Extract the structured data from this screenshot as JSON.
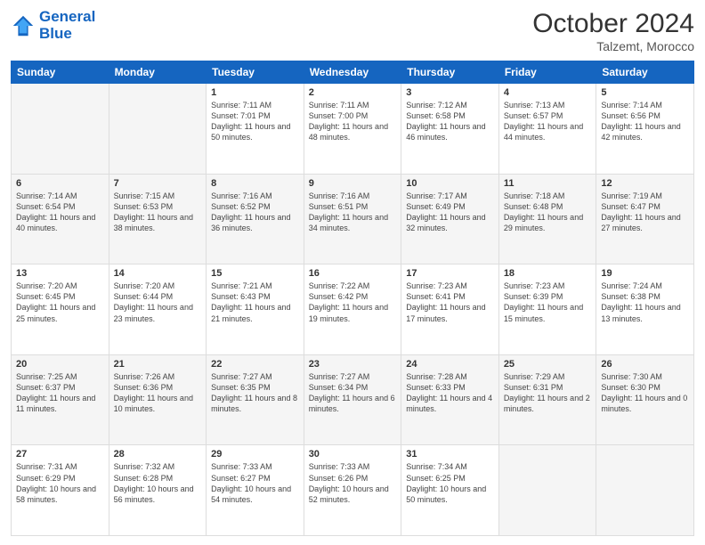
{
  "header": {
    "logo_line1": "General",
    "logo_line2": "Blue",
    "month_year": "October 2024",
    "location": "Talzemt, Morocco"
  },
  "days_of_week": [
    "Sunday",
    "Monday",
    "Tuesday",
    "Wednesday",
    "Thursday",
    "Friday",
    "Saturday"
  ],
  "weeks": [
    [
      {
        "day": "",
        "info": ""
      },
      {
        "day": "",
        "info": ""
      },
      {
        "day": "1",
        "info": "Sunrise: 7:11 AM\nSunset: 7:01 PM\nDaylight: 11 hours and 50 minutes."
      },
      {
        "day": "2",
        "info": "Sunrise: 7:11 AM\nSunset: 7:00 PM\nDaylight: 11 hours and 48 minutes."
      },
      {
        "day": "3",
        "info": "Sunrise: 7:12 AM\nSunset: 6:58 PM\nDaylight: 11 hours and 46 minutes."
      },
      {
        "day": "4",
        "info": "Sunrise: 7:13 AM\nSunset: 6:57 PM\nDaylight: 11 hours and 44 minutes."
      },
      {
        "day": "5",
        "info": "Sunrise: 7:14 AM\nSunset: 6:56 PM\nDaylight: 11 hours and 42 minutes."
      }
    ],
    [
      {
        "day": "6",
        "info": "Sunrise: 7:14 AM\nSunset: 6:54 PM\nDaylight: 11 hours and 40 minutes."
      },
      {
        "day": "7",
        "info": "Sunrise: 7:15 AM\nSunset: 6:53 PM\nDaylight: 11 hours and 38 minutes."
      },
      {
        "day": "8",
        "info": "Sunrise: 7:16 AM\nSunset: 6:52 PM\nDaylight: 11 hours and 36 minutes."
      },
      {
        "day": "9",
        "info": "Sunrise: 7:16 AM\nSunset: 6:51 PM\nDaylight: 11 hours and 34 minutes."
      },
      {
        "day": "10",
        "info": "Sunrise: 7:17 AM\nSunset: 6:49 PM\nDaylight: 11 hours and 32 minutes."
      },
      {
        "day": "11",
        "info": "Sunrise: 7:18 AM\nSunset: 6:48 PM\nDaylight: 11 hours and 29 minutes."
      },
      {
        "day": "12",
        "info": "Sunrise: 7:19 AM\nSunset: 6:47 PM\nDaylight: 11 hours and 27 minutes."
      }
    ],
    [
      {
        "day": "13",
        "info": "Sunrise: 7:20 AM\nSunset: 6:45 PM\nDaylight: 11 hours and 25 minutes."
      },
      {
        "day": "14",
        "info": "Sunrise: 7:20 AM\nSunset: 6:44 PM\nDaylight: 11 hours and 23 minutes."
      },
      {
        "day": "15",
        "info": "Sunrise: 7:21 AM\nSunset: 6:43 PM\nDaylight: 11 hours and 21 minutes."
      },
      {
        "day": "16",
        "info": "Sunrise: 7:22 AM\nSunset: 6:42 PM\nDaylight: 11 hours and 19 minutes."
      },
      {
        "day": "17",
        "info": "Sunrise: 7:23 AM\nSunset: 6:41 PM\nDaylight: 11 hours and 17 minutes."
      },
      {
        "day": "18",
        "info": "Sunrise: 7:23 AM\nSunset: 6:39 PM\nDaylight: 11 hours and 15 minutes."
      },
      {
        "day": "19",
        "info": "Sunrise: 7:24 AM\nSunset: 6:38 PM\nDaylight: 11 hours and 13 minutes."
      }
    ],
    [
      {
        "day": "20",
        "info": "Sunrise: 7:25 AM\nSunset: 6:37 PM\nDaylight: 11 hours and 11 minutes."
      },
      {
        "day": "21",
        "info": "Sunrise: 7:26 AM\nSunset: 6:36 PM\nDaylight: 11 hours and 10 minutes."
      },
      {
        "day": "22",
        "info": "Sunrise: 7:27 AM\nSunset: 6:35 PM\nDaylight: 11 hours and 8 minutes."
      },
      {
        "day": "23",
        "info": "Sunrise: 7:27 AM\nSunset: 6:34 PM\nDaylight: 11 hours and 6 minutes."
      },
      {
        "day": "24",
        "info": "Sunrise: 7:28 AM\nSunset: 6:33 PM\nDaylight: 11 hours and 4 minutes."
      },
      {
        "day": "25",
        "info": "Sunrise: 7:29 AM\nSunset: 6:31 PM\nDaylight: 11 hours and 2 minutes."
      },
      {
        "day": "26",
        "info": "Sunrise: 7:30 AM\nSunset: 6:30 PM\nDaylight: 11 hours and 0 minutes."
      }
    ],
    [
      {
        "day": "27",
        "info": "Sunrise: 7:31 AM\nSunset: 6:29 PM\nDaylight: 10 hours and 58 minutes."
      },
      {
        "day": "28",
        "info": "Sunrise: 7:32 AM\nSunset: 6:28 PM\nDaylight: 10 hours and 56 minutes."
      },
      {
        "day": "29",
        "info": "Sunrise: 7:33 AM\nSunset: 6:27 PM\nDaylight: 10 hours and 54 minutes."
      },
      {
        "day": "30",
        "info": "Sunrise: 7:33 AM\nSunset: 6:26 PM\nDaylight: 10 hours and 52 minutes."
      },
      {
        "day": "31",
        "info": "Sunrise: 7:34 AM\nSunset: 6:25 PM\nDaylight: 10 hours and 50 minutes."
      },
      {
        "day": "",
        "info": ""
      },
      {
        "day": "",
        "info": ""
      }
    ]
  ]
}
